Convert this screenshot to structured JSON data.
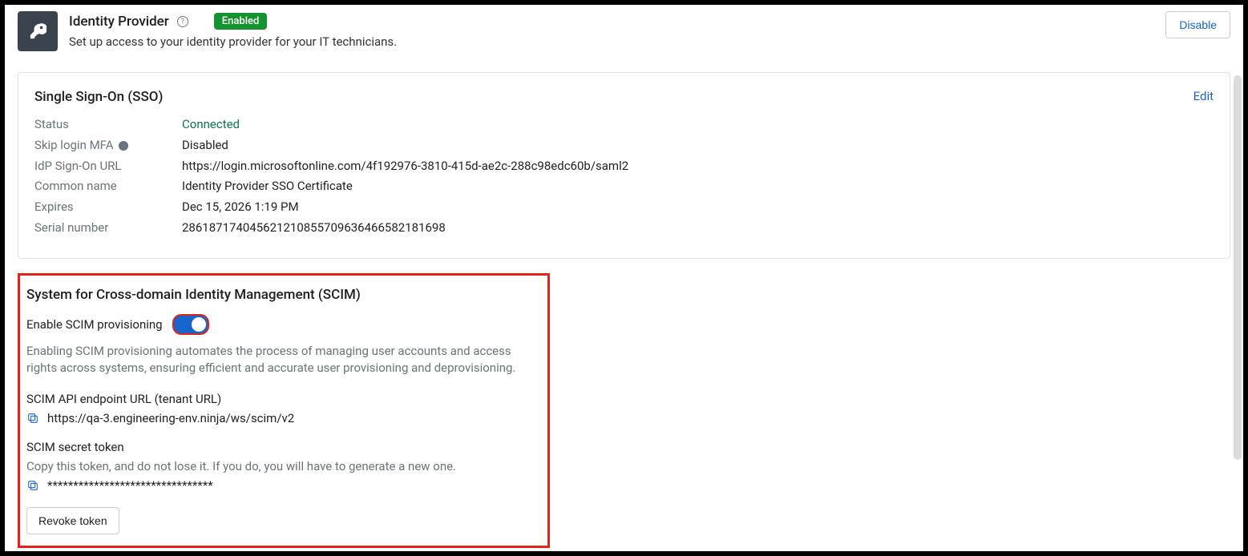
{
  "header": {
    "title": "Identity Provider",
    "badge": "Enabled",
    "subtitle": "Set up access to your identity provider for your IT technicians.",
    "disable_btn": "Disable"
  },
  "sso": {
    "title": "Single Sign-On (SSO)",
    "edit": "Edit",
    "rows": {
      "status_label": "Status",
      "status_value": "Connected",
      "mfa_label": "Skip login MFA",
      "mfa_value": "Disabled",
      "url_label": "IdP Sign-On URL",
      "url_value": "https://login.microsoftonline.com/4f192976-3810-415d-ae2c-288c98edc60b/saml2",
      "cn_label": "Common name",
      "cn_value": "Identity Provider SSO Certificate",
      "exp_label": "Expires",
      "exp_value": "Dec 15, 2026 1:19 PM",
      "sn_label": "Serial number",
      "sn_value": "286187174045621210855709636466582181698"
    }
  },
  "scim": {
    "title": "System for Cross-domain Identity Management (SCIM)",
    "toggle_label": "Enable SCIM provisioning",
    "desc": "Enabling SCIM provisioning automates the process of managing user accounts and access rights across systems, ensuring efficient and accurate user provisioning and deprovisioning.",
    "endpoint_label": "SCIM API endpoint URL (tenant URL)",
    "endpoint_value": "https://qa-3.engineering-env.ninja/ws/scim/v2",
    "token_label": "SCIM secret token",
    "token_help": "Copy this token, and do not lose it. If you do, you will have to generate a new one.",
    "token_value": "********************************",
    "revoke_btn": "Revoke token"
  }
}
